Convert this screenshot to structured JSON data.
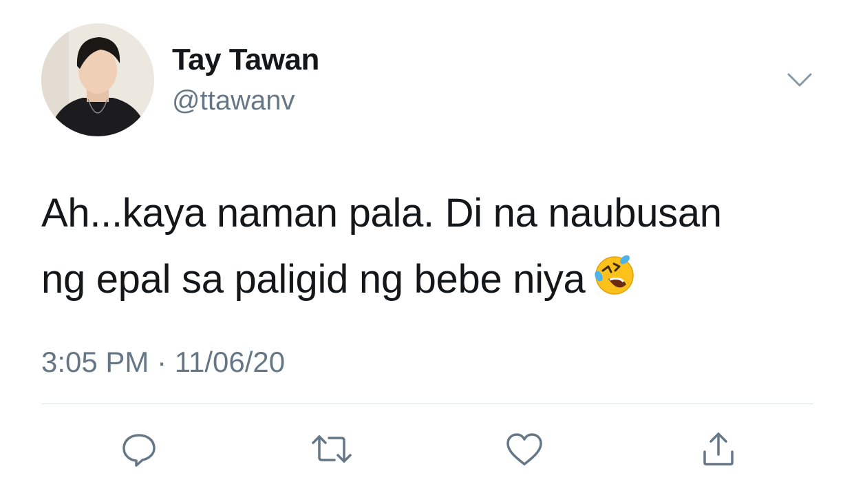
{
  "author": {
    "display_name": "Tay Tawan",
    "handle": "@ttawanv"
  },
  "tweet": {
    "text_line1": "Ah...kaya naman pala. Di na naubusan",
    "text_line2": "ng epal sa paligid ng bebe niya",
    "emoji": "rolling-on-the-floor-laughing-emoji",
    "timestamp": "3:05 PM · 11/06/20"
  },
  "actions": [
    {
      "icon": "reply-icon"
    },
    {
      "icon": "retweet-icon"
    },
    {
      "icon": "like-icon"
    },
    {
      "icon": "share-icon"
    }
  ],
  "colors": {
    "text_primary": "#14171a",
    "text_secondary": "#657786",
    "icon": "#657786",
    "divider": "#d9dee2",
    "background": "#ffffff"
  }
}
